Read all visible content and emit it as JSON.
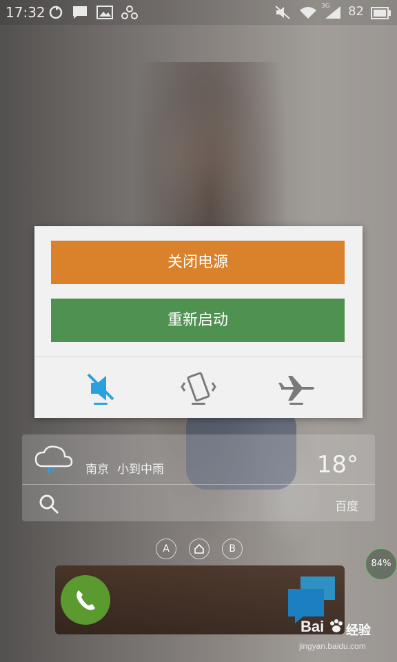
{
  "status_bar": {
    "time": "17:32",
    "battery": "82",
    "network": "3G",
    "icons": [
      "sync-icon",
      "message-icon",
      "image-icon",
      "network-icon",
      "mute-icon",
      "wifi-icon",
      "signal-icon",
      "battery-icon"
    ]
  },
  "power_dialog": {
    "power_off_label": "关闭电源",
    "restart_label": "重新启动",
    "colors": {
      "power_off": "#d9822b",
      "restart": "#4f9150",
      "active_indicator": "#2aa1de",
      "inactive_indicator": "#7a7a7a"
    },
    "quick_toggles": [
      {
        "name": "silent-mode",
        "icon": "mute-icon",
        "active": true
      },
      {
        "name": "vibrate-mode",
        "icon": "vibrate-icon",
        "active": false
      },
      {
        "name": "airplane-mode",
        "icon": "airplane-icon",
        "active": false
      }
    ]
  },
  "weather_widget": {
    "city": "南京",
    "condition": "小到中雨",
    "temperature": "18°",
    "search_label": "百度"
  },
  "home_dock": {
    "page_dots": [
      "A",
      "",
      "B"
    ],
    "memory_percent": "84%"
  },
  "watermark": {
    "logo": "Bai",
    "text": "经验",
    "url": "jingyan.baidu.com"
  }
}
